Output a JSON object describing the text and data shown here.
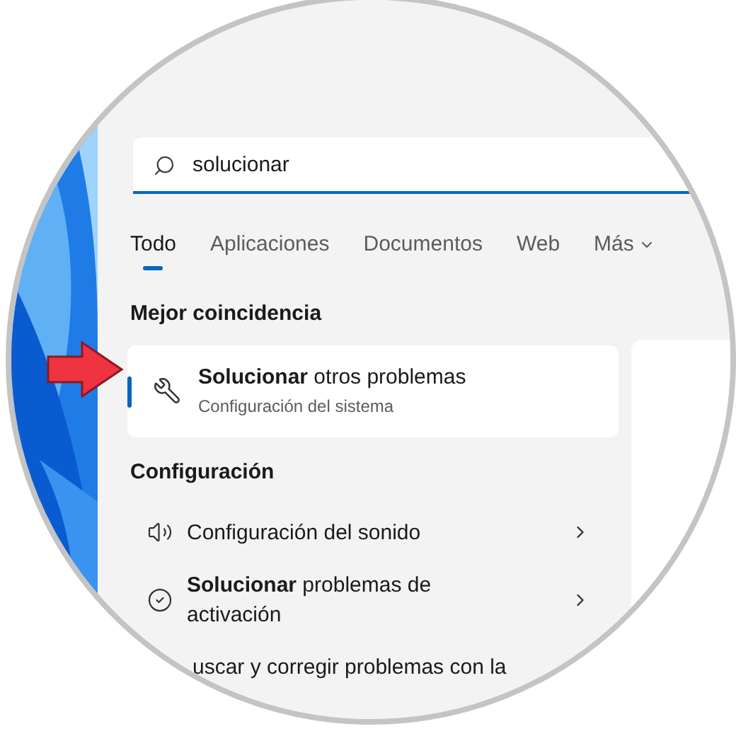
{
  "search": {
    "value": "solucionar"
  },
  "tabs": [
    {
      "label": "Todo",
      "selected": true,
      "kind": "tab"
    },
    {
      "label": "Aplicaciones",
      "selected": false,
      "kind": "tab"
    },
    {
      "label": "Documentos",
      "selected": false,
      "kind": "tab"
    },
    {
      "label": "Web",
      "selected": false,
      "kind": "tab"
    },
    {
      "label": "Más",
      "selected": false,
      "kind": "menu"
    }
  ],
  "best_match": {
    "heading": "Mejor coincidencia",
    "title": "**Solucionar** otros problemas",
    "subtitle": "Configuración del sistema",
    "selected": true
  },
  "settings": {
    "heading": "Configuración",
    "items": [
      {
        "kind": "sound",
        "text": "Configuración del sonido"
      },
      {
        "kind": "activation",
        "text": "**Solucionar** problemas de activación"
      },
      {
        "kind": "text",
        "text": "uscar y corregir problemas con la"
      }
    ]
  }
}
